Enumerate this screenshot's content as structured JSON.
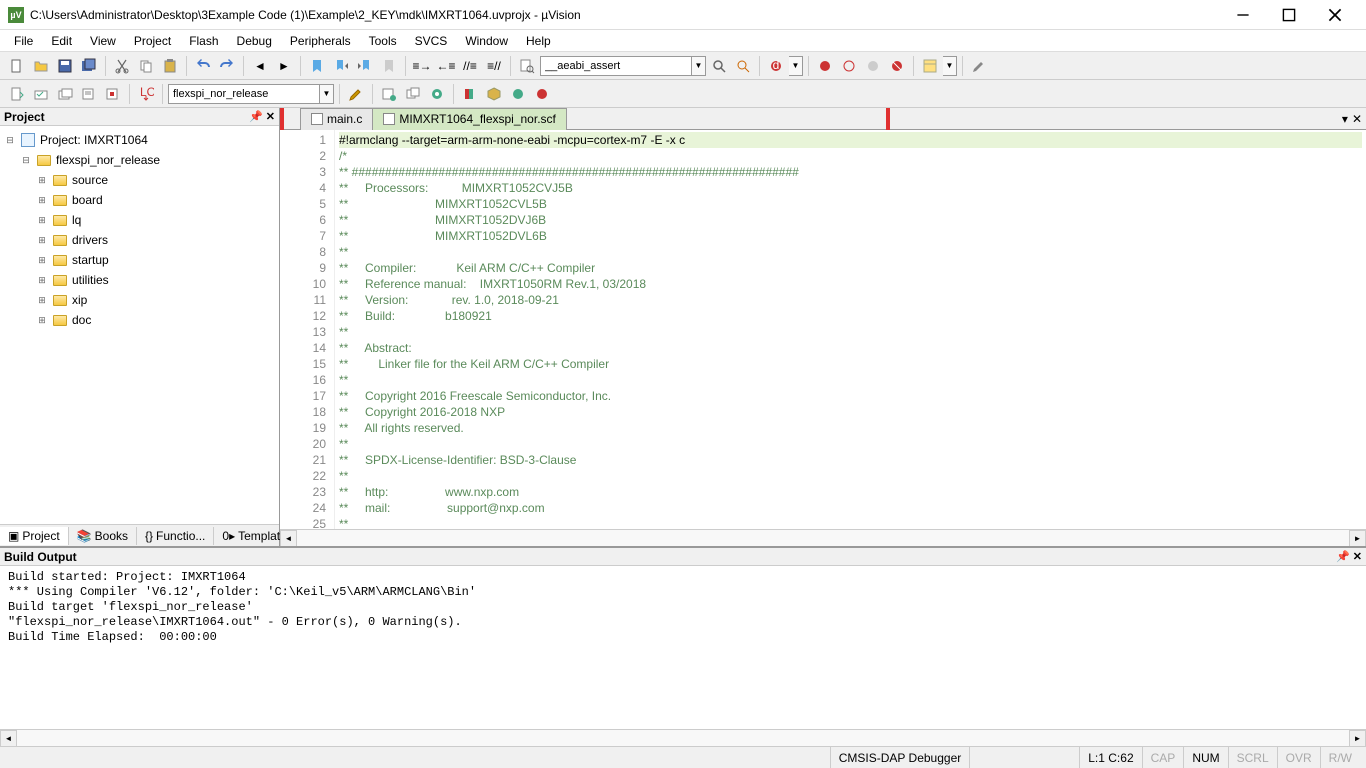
{
  "title": "C:\\Users\\Administrator\\Desktop\\3Example Code (1)\\Example\\2_KEY\\mdk\\IMXRT1064.uvprojx - µVision",
  "app_icon_text": "µV",
  "menu": [
    "File",
    "Edit",
    "View",
    "Project",
    "Flash",
    "Debug",
    "Peripherals",
    "Tools",
    "SVCS",
    "Window",
    "Help"
  ],
  "toolbar2_combo": "flexspi_nor_release",
  "toolbar1_combo": "__aeabi_assert",
  "project_panel": {
    "title": "Project",
    "root": "Project: IMXRT1064",
    "target": "flexspi_nor_release",
    "groups": [
      "source",
      "board",
      "lq",
      "drivers",
      "startup",
      "utilities",
      "xip",
      "doc"
    ],
    "tabs": [
      "Project",
      "Books",
      "Functio...",
      "Templat..."
    ]
  },
  "editor": {
    "tabs": [
      {
        "label": "main.c",
        "active": false
      },
      {
        "label": "MIMXRT1064_flexspi_nor.scf",
        "active": true
      }
    ],
    "lines": [
      "#!armclang --target=arm-arm-none-eabi -mcpu=cortex-m7 -E -x c",
      "/*",
      "** ###################################################################",
      "**     Processors:          MIMXRT1052CVJ5B",
      "**                          MIMXRT1052CVL5B",
      "**                          MIMXRT1052DVJ6B",
      "**                          MIMXRT1052DVL6B",
      "**",
      "**     Compiler:            Keil ARM C/C++ Compiler",
      "**     Reference manual:    IMXRT1050RM Rev.1, 03/2018",
      "**     Version:             rev. 1.0, 2018-09-21",
      "**     Build:               b180921",
      "**",
      "**     Abstract:",
      "**         Linker file for the Keil ARM C/C++ Compiler",
      "**",
      "**     Copyright 2016 Freescale Semiconductor, Inc.",
      "**     Copyright 2016-2018 NXP",
      "**     All rights reserved.",
      "**",
      "**     SPDX-License-Identifier: BSD-3-Clause",
      "**",
      "**     http:                 www.nxp.com",
      "**     mail:                 support@nxp.com",
      "**"
    ]
  },
  "build_output": {
    "title": "Build Output",
    "lines": [
      "Build started: Project: IMXRT1064",
      "*** Using Compiler 'V6.12', folder: 'C:\\Keil_v5\\ARM\\ARMCLANG\\Bin'",
      "Build target 'flexspi_nor_release'",
      "\"flexspi_nor_release\\IMXRT1064.out\" - 0 Error(s), 0 Warning(s).",
      "Build Time Elapsed:  00:00:00"
    ]
  },
  "status": {
    "debugger": "CMSIS-DAP Debugger",
    "pos": "L:1 C:62",
    "caps": "CAP",
    "num": "NUM",
    "scrl": "SCRL",
    "ovr": "OVR",
    "rw": "R/W"
  }
}
